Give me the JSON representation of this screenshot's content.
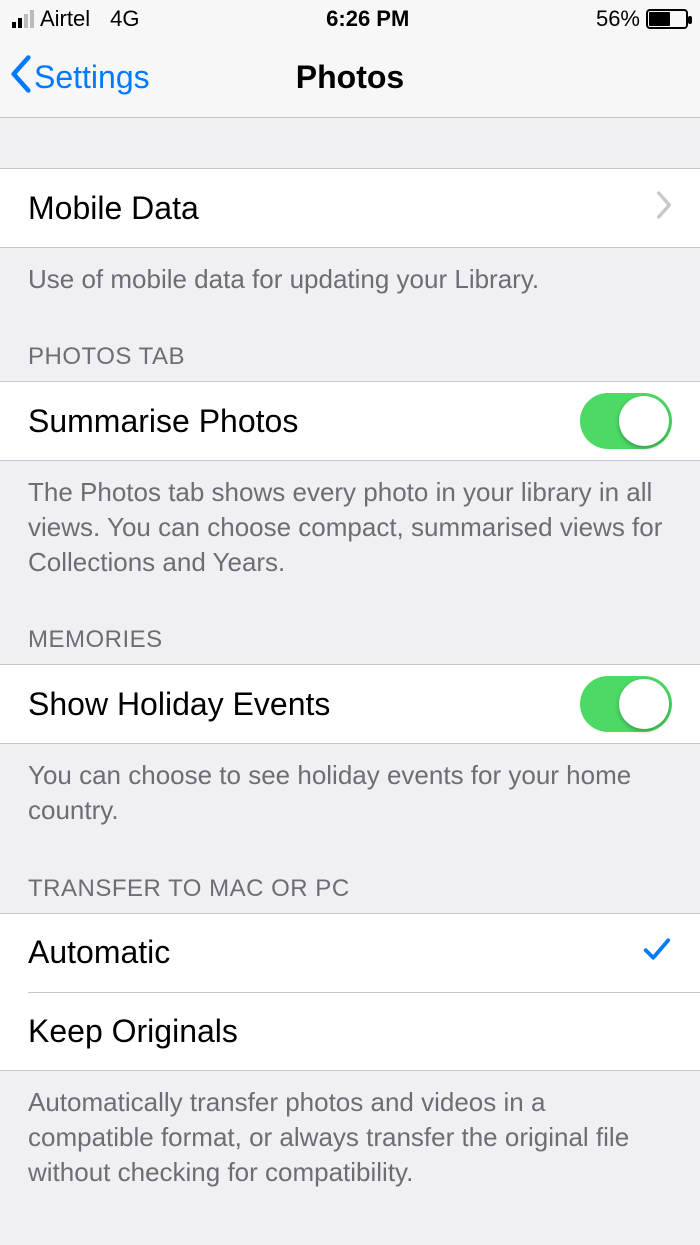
{
  "statusbar": {
    "carrier": "Airtel",
    "network": "4G",
    "time": "6:26 PM",
    "battery_percent": "56%"
  },
  "nav": {
    "back_label": "Settings",
    "title": "Photos"
  },
  "mobile_data": {
    "label": "Mobile Data",
    "footer": "Use of mobile data for updating your Library."
  },
  "photos_tab": {
    "header": "PHOTOS TAB",
    "summarise_label": "Summarise Photos",
    "summarise_on": true,
    "footer": "The Photos tab shows every photo in your library in all views. You can choose compact, summarised views for Collections and Years."
  },
  "memories": {
    "header": "MEMORIES",
    "holiday_label": "Show Holiday Events",
    "holiday_on": true,
    "footer": "You can choose to see holiday events for your home country."
  },
  "transfer": {
    "header": "TRANSFER TO MAC OR PC",
    "automatic_label": "Automatic",
    "keep_originals_label": "Keep Originals",
    "selected": "automatic",
    "footer": "Automatically transfer photos and videos in a compatible format, or always transfer the original file without checking for compatibility."
  }
}
